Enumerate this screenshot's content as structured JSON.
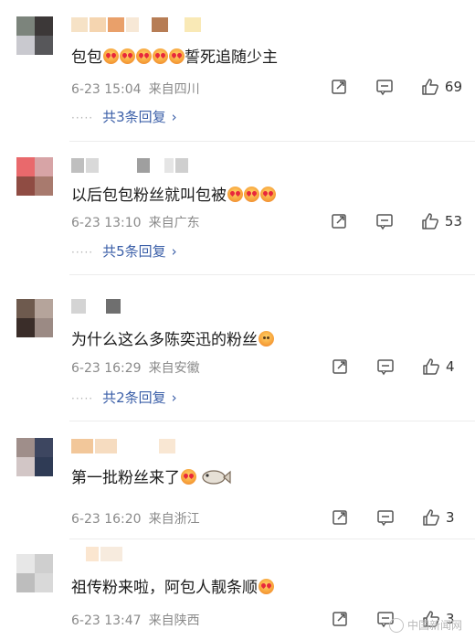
{
  "comments": [
    {
      "text": "包包",
      "suffix": "誓死追随少主",
      "time": "6-23 15:04",
      "source": "来自四川",
      "likes": "69",
      "replies": "共3条回复",
      "avatar": [
        "#7c847c",
        "#3c3838",
        "#c9c9cf",
        "#57575a"
      ],
      "name_colors": [
        "#f6e2c6",
        "#f5d5b0",
        "#e9a06a",
        "#f7e8d6",
        "#b77d55",
        "#f9e9b6"
      ]
    },
    {
      "text": "以后包包粉丝就叫包被",
      "time": "6-23 13:10",
      "source": "来自广东",
      "likes": "53",
      "replies": "共5条回复",
      "avatar": [
        "#e9696c",
        "#d7a4a6",
        "#8f4c43",
        "#a87a6e"
      ],
      "name_colors": [
        "#bfbfbf",
        "#d9d9d9",
        "#9f9f9f",
        "#e5e5e5",
        "#cfcfcf"
      ]
    },
    {
      "text": "为什么这么多陈奕迅的粉丝",
      "time": "6-23 16:29",
      "source": "来自安徽",
      "likes": "4",
      "replies": "共2条回复",
      "avatar": [
        "#6e5a4e",
        "#b5a49b",
        "#3a2d29",
        "#9b8a84"
      ],
      "name_colors": [
        "#d4d4d4",
        "#6f6f6f"
      ]
    },
    {
      "text": "第一批粉丝来了",
      "time": "6-23 16:20",
      "source": "来自浙江",
      "likes": "3",
      "avatar": [
        "#9f8e8a",
        "#3d4660",
        "#d2c6c6",
        "#2f3b55"
      ],
      "name_colors": [
        "#f2c79a",
        "#f6dcc0",
        "#f9e7d3"
      ]
    },
    {
      "text": "祖传粉来啦，阿包人靓条顺",
      "time": "6-23 13:47",
      "source": "来自陕西",
      "likes": "3",
      "avatar": [
        "#e7e7e7",
        "#cfcfcf",
        "#bdbdbd",
        "#d9d9d9"
      ],
      "name_colors": [
        "#fbe6d0",
        "#f7ebde"
      ]
    }
  ],
  "icons": {
    "share": "share-icon",
    "comment": "comment-icon",
    "like": "thumbs-up-icon",
    "chevron": "chevron-right-icon"
  },
  "watermark": "中国新闻网"
}
